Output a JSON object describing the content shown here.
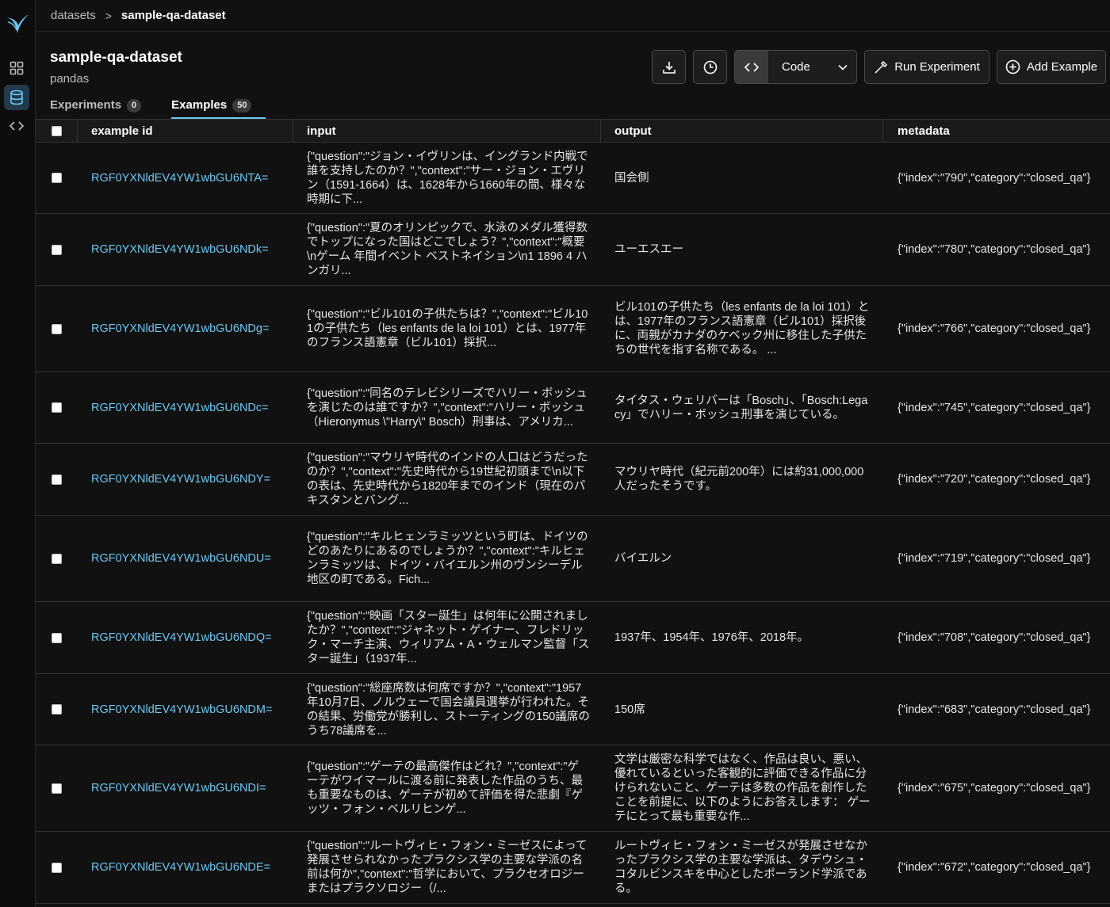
{
  "breadcrumb": {
    "root": "datasets",
    "separator": ">",
    "current": "sample-qa-dataset"
  },
  "header": {
    "title": "sample-qa-dataset",
    "subtitle": "pandas"
  },
  "tabs": [
    {
      "label": "Experiments",
      "count": "0"
    },
    {
      "label": "Examples",
      "count": "50"
    }
  ],
  "toolbar": {
    "code_label": "Code",
    "run_experiment_label": "Run Experiment",
    "add_example_label": "Add Example"
  },
  "table": {
    "headers": {
      "example_id": "example id",
      "input": "input",
      "output": "output",
      "metadata": "metadata"
    },
    "rows": [
      {
        "id": "RGF0YXNldEV4YW1wbGU6NTA=",
        "input": "{\"question\":\"ジョン・イヴリンは、イングランド内戦で誰を支持したのか？\",\"context\":\"サー・ジョン・エヴリン（1591-1664）は、1628年から1660年の間、様々な時期に下...",
        "output": "国会側",
        "metadata": "{\"index\":\"790\",\"category\":\"closed_qa\"}"
      },
      {
        "id": "RGF0YXNldEV4YW1wbGU6NDk=",
        "input": "{\"question\":\"夏のオリンピックで、水泳のメダル獲得数でトップになった国はどこでしょう？\",\"context\":\"概要\\nゲーム 年間イベント ベストネイション\\n1 1896 4 ハンガリ...",
        "output": "ユーエスエー",
        "metadata": "{\"index\":\"780\",\"category\":\"closed_qa\"}"
      },
      {
        "id": "RGF0YXNldEV4YW1wbGU6NDg=",
        "input": "{\"question\":\"ビル101の子供たちは？\",\"context\":\"ビル101の子供たち（les enfants de la loi 101）とは、1977年のフランス語憲章（ビル101）採択...",
        "output": "ビル101の子供たち（les enfants de la loi 101）とは、1977年のフランス語憲章（ビル101）採択後に、両親がカナダのケベック州に移住した子供たちの世代を指す名称である。 ...",
        "metadata": "{\"index\":\"766\",\"category\":\"closed_qa\"}"
      },
      {
        "id": "RGF0YXNldEV4YW1wbGU6NDc=",
        "input": "{\"question\":\"同名のテレビシリーズでハリー・ボッシュを演じたのは誰ですか？\",\"context\":\"ハリー・ボッシュ（Hieronymus \\\"Harry\\\" Bosch）刑事は、アメリカ...",
        "output": "タイタス・ウェリバーは「Bosch」、「Bosch:Legacy」でハリー・ボッシュ刑事を演じている。",
        "metadata": "{\"index\":\"745\",\"category\":\"closed_qa\"}"
      },
      {
        "id": "RGF0YXNldEV4YW1wbGU6NDY=",
        "input": "{\"question\":\"マウリヤ時代のインドの人口はどうだったのか？\",\"context\":\"先史時代から19世紀初頭まで\\n以下の表は、先史時代から1820年までのインド（現在のパキスタンとバング...",
        "output": "マウリヤ時代（紀元前200年）には約31,000,000人だったそうです。",
        "metadata": "{\"index\":\"720\",\"category\":\"closed_qa\"}"
      },
      {
        "id": "RGF0YXNldEV4YW1wbGU6NDU=",
        "input": "{\"question\":\"キルヒェンラミッツという町は、ドイツのどのあたりにあるのでしょうか？\",\"context\":\"キルヒェンラミッツは、ドイツ・バイエルン州のヴンシーデル地区の町である。Fich...",
        "output": "バイエルン",
        "metadata": "{\"index\":\"719\",\"category\":\"closed_qa\"}"
      },
      {
        "id": "RGF0YXNldEV4YW1wbGU6NDQ=",
        "input": "{\"question\":\"映画「スター誕生」は何年に公開されましたか？\",\"context\":\"ジャネット・ゲイナー、フレドリック・マーチ主演、ウィリアム・A・ウェルマン監督「スター誕生」（1937年...",
        "output": "1937年、1954年、1976年、2018年。",
        "metadata": "{\"index\":\"708\",\"category\":\"closed_qa\"}"
      },
      {
        "id": "RGF0YXNldEV4YW1wbGU6NDM=",
        "input": "{\"question\":\"総座席数は何席ですか？\",\"context\":\"1957年10月7日、ノルウェーで国会議員選挙が行われた。その結果、労働党が勝利し、ストーティングの150議席のうち78議席を...",
        "output": "150席",
        "metadata": "{\"index\":\"683\",\"category\":\"closed_qa\"}"
      },
      {
        "id": "RGF0YXNldEV4YW1wbGU6NDI=",
        "input": "{\"question\":\"ゲーテの最高傑作はどれ？\",\"context\":\"ゲーテがワイマールに渡る前に発表した作品のうち、最も重要なものは、ゲーテが初めて評価を得た悲劇『ゲッツ・フォン・ベルリヒンゲ...",
        "output": "文学は厳密な科学ではなく、作品は良い、悪い、優れているといった客観的に評価できる作品に分けられないこと、ゲーテは多数の作品を創作したことを前提に、以下のようにお答えします： ゲーテにとって最も重要な作...",
        "metadata": "{\"index\":\"675\",\"category\":\"closed_qa\"}"
      },
      {
        "id": "RGF0YXNldEV4YW1wbGU6NDE=",
        "input": "{\"question\":\"ルートヴィヒ・フォン・ミーゼスによって発展させられなかったプラクシス学の主要な学派の名前は何か\",\"context\":\"哲学において、プラクセオロジーまたはプラクソロジー（/...",
        "output": "ルートヴィヒ・フォン・ミーゼスが発展させなかったプラクシス学の主要な学派は、タデウシュ・コタルビンスキを中心としたポーランド学派である。",
        "metadata": "{\"index\":\"672\",\"category\":\"closed_qa\"}"
      }
    ]
  }
}
